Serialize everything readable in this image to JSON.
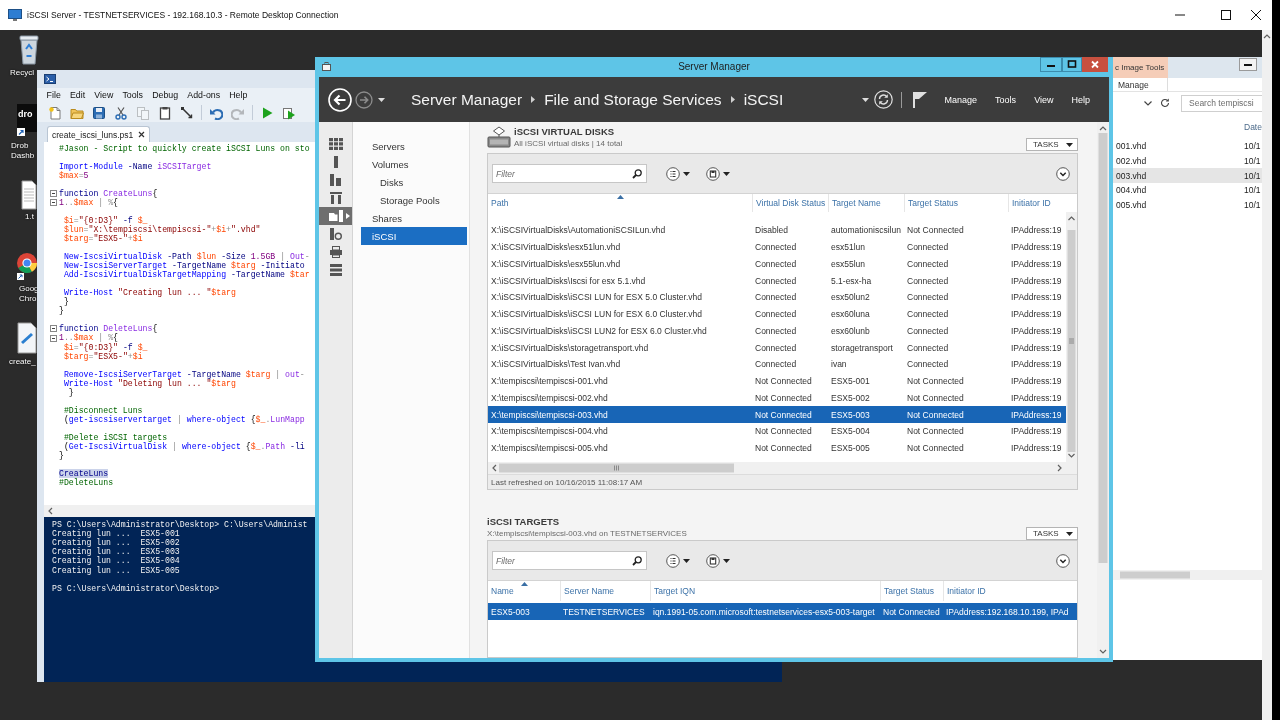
{
  "remote_desktop": {
    "title": "iSCSI Server - TESTNETSERVICES - 192.168.10.3 - Remote Desktop Connection"
  },
  "desktop_icons": [
    {
      "kind": "recycle-bin",
      "label": [
        "Recycl"
      ]
    },
    {
      "kind": "app-tile",
      "tile_text": "dro",
      "label": [
        "Drob",
        "Dashb"
      ]
    },
    {
      "kind": "text-file",
      "label": [
        "1.t"
      ]
    },
    {
      "kind": "browser",
      "label": [
        "Goog",
        "Chro"
      ]
    },
    {
      "kind": "script",
      "label": [
        "create_"
      ]
    }
  ],
  "ise": {
    "menu": [
      "File",
      "Edit",
      "View",
      "Tools",
      "Debug",
      "Add-ons",
      "Help"
    ],
    "toolbar": [
      [
        {
          "kind": "new",
          "disabled": false
        },
        {
          "kind": "open",
          "disabled": false
        },
        {
          "kind": "save",
          "disabled": false
        },
        {
          "kind": "cut",
          "disabled": false
        },
        {
          "kind": "copy",
          "disabled": true
        },
        {
          "kind": "paste",
          "disabled": false
        },
        {
          "kind": "clear",
          "disabled": false
        }
      ],
      [
        {
          "kind": "undo",
          "disabled": false
        },
        {
          "kind": "redo",
          "disabled": true
        }
      ],
      [
        {
          "kind": "run",
          "disabled": false
        },
        {
          "kind": "run-selection",
          "disabled": false
        }
      ]
    ],
    "tab": {
      "label": "create_iscsi_luns.ps1",
      "selected": true
    },
    "code": [
      [
        {
          "text": "#Jason - Script to quickly create iSCSI Luns on sto",
          "fold": false,
          "selected": false
        }
      ],
      [
        {
          "text": "Import-Module -Name iSCSITarget",
          "fold": false,
          "selected": false
        },
        {
          "text": "$max=5",
          "fold": false,
          "selected": false
        }
      ],
      [
        {
          "text": "function CreateLuns{",
          "fold": true,
          "selected": false
        },
        {
          "text": "1..$max | %{",
          "fold": true,
          "selected": false
        }
      ],
      [
        {
          "text": " $i=\"{0:D3}\" -f $_",
          "fold": false,
          "selected": false
        },
        {
          "text": " $lun=\"X:\\tempiscsi\\tempiscsi-\"+$i+\".vhd\"",
          "fold": false,
          "selected": false
        },
        {
          "text": " $targ=\"ESX5-\"+$i",
          "fold": false,
          "selected": false
        }
      ],
      [
        {
          "text": " New-IscsiVirtualDisk -Path $lun -Size 1.5GB | Out-",
          "fold": false,
          "selected": false
        },
        {
          "text": " New-IscsiServerTarget -TargetName $targ -Initiato",
          "fold": false,
          "selected": false
        },
        {
          "text": " Add-IscsiVirtualDiskTargetMapping -TargetName $tar",
          "fold": false,
          "selected": false
        }
      ],
      [
        {
          "text": " Write-Host \"Creating lun ... \"$targ",
          "fold": false,
          "selected": false
        },
        {
          "text": " }",
          "fold": false,
          "selected": false
        },
        {
          "text": "}",
          "fold": false,
          "selected": false
        }
      ],
      [
        {
          "text": "function DeleteLuns{",
          "fold": true,
          "selected": false
        },
        {
          "text": "1..$max | %{",
          "fold": true,
          "selected": false
        },
        {
          "text": " $i=\"{0:D3}\" -f $_",
          "fold": false,
          "selected": false
        },
        {
          "text": " $targ=\"ESX5-\"+$i",
          "fold": false,
          "selected": false
        }
      ],
      [
        {
          "text": " Remove-IscsiServerTarget -TargetName $targ | out-",
          "fold": false,
          "selected": false
        },
        {
          "text": " Write-Host \"Deleting lun ... \"$targ",
          "fold": false,
          "selected": false
        },
        {
          "text": "  }",
          "fold": false,
          "selected": false
        }
      ],
      [
        {
          "text": " #Disconnect Luns",
          "fold": false,
          "selected": false
        },
        {
          "text": " (get-iscsiservertarget | where-object {$_.LunMapp",
          "fold": false,
          "selected": false
        }
      ],
      [
        {
          "text": " #Delete iSCSI targets",
          "fold": false,
          "selected": false
        },
        {
          "text": " (Get-IscsiVirtualDisk | where-object {$_.Path -li",
          "fold": false,
          "selected": false
        },
        {
          "text": "}",
          "fold": false,
          "selected": false
        }
      ],
      [
        {
          "text": "CreateLuns",
          "fold": false,
          "selected": true
        },
        {
          "text": "#DeleteLuns",
          "fold": false,
          "selected": false
        }
      ]
    ],
    "console": [
      [
        "PS C:\\Users\\Administrator\\Desktop> C:\\Users\\Administ",
        "Creating lun ...  ESX5-001",
        "Creating lun ...  ESX5-002",
        "Creating lun ...  ESX5-003",
        "Creating lun ...  ESX5-004",
        "Creating lun ...  ESX5-005"
      ],
      [
        "PS C:\\Users\\Administrator\\Desktop>"
      ]
    ]
  },
  "server_manager": {
    "title": "Server Manager",
    "nav_buttons": [
      {
        "kind": "back",
        "disabled": false
      },
      {
        "kind": "forward",
        "disabled": true
      }
    ],
    "breadcrumb": [
      "Server Manager",
      "File and Storage Services",
      "iSCSI"
    ],
    "menu": [
      "Manage",
      "Tools",
      "View",
      "Help"
    ],
    "rail": [
      {
        "kind": "dashboard",
        "selected": false
      },
      {
        "kind": "local-server",
        "selected": false
      },
      {
        "kind": "all-servers",
        "selected": false
      },
      {
        "kind": "roles",
        "selected": false
      },
      {
        "kind": "file-storage",
        "selected": true
      },
      {
        "kind": "iis",
        "selected": false
      },
      {
        "kind": "print",
        "selected": false
      },
      {
        "kind": "remote",
        "selected": false
      }
    ],
    "nav": [
      {
        "label": "Servers",
        "selected": false
      },
      {
        "label": "Volumes",
        "selected": false,
        "children": [
          {
            "label": "Disks",
            "selected": false
          },
          {
            "label": "Storage Pools",
            "selected": false
          }
        ]
      },
      {
        "label": "Shares",
        "selected": false
      },
      {
        "label": "iSCSI",
        "selected": true
      }
    ],
    "virtual_disks": {
      "title": "iSCSI VIRTUAL DISKS",
      "subtitle": "All iSCSI virtual disks | 14 total",
      "tasks": "TASKS",
      "filter": {
        "placeholder": "Filter"
      },
      "columns": [
        {
          "label": "Path",
          "sorted": true
        },
        {
          "label": "Virtual Disk Status",
          "sorted": false
        },
        {
          "label": "Target Name",
          "sorted": false
        },
        {
          "label": "Target Status",
          "sorted": false
        },
        {
          "label": "Initiator ID",
          "sorted": false
        }
      ],
      "rows": [
        {
          "cells": [
            "X:\\iSCSIVirtualDisks\\AutomationiSCSILun.vhd",
            "Disabled",
            "automationiscsilun",
            "Not Connected",
            "IPAddress:19"
          ],
          "selected": false
        },
        {
          "cells": [
            "X:\\iSCSIVirtualDisks\\esx51lun.vhd",
            "Connected",
            "esx51lun",
            "Connected",
            "IPAddress:19"
          ],
          "selected": false
        },
        {
          "cells": [
            "X:\\iSCSIVirtualDisks\\esx55lun.vhd",
            "Connected",
            "esx55lun",
            "Connected",
            "IPAddress:19"
          ],
          "selected": false
        },
        {
          "cells": [
            "X:\\iSCSIVirtualDisks\\Iscsi for esx 5.1.vhd",
            "Connected",
            "5.1-esx-ha",
            "Connected",
            "IPAddress:19"
          ],
          "selected": false
        },
        {
          "cells": [
            "X:\\iSCSIVirtualDisks\\iSCSI LUN for ESX 5.0 Cluster.vhd",
            "Connected",
            "esx50lun2",
            "Connected",
            "IPAddress:19"
          ],
          "selected": false
        },
        {
          "cells": [
            "X:\\iSCSIVirtualDisks\\iSCSI LUN for ESX 6.0 Cluster.vhd",
            "Connected",
            "esx60luna",
            "Connected",
            "IPAddress:19"
          ],
          "selected": false
        },
        {
          "cells": [
            "X:\\iSCSIVirtualDisks\\iSCSI LUN2 for ESX 6.0 Cluster.vhd",
            "Connected",
            "esx60lunb",
            "Connected",
            "IPAddress:19"
          ],
          "selected": false
        },
        {
          "cells": [
            "X:\\iSCSIVirtualDisks\\storagetransport.vhd",
            "Connected",
            "storagetransport",
            "Connected",
            "IPAddress:19"
          ],
          "selected": false
        },
        {
          "cells": [
            "X:\\iSCSIVirtualDisks\\Test Ivan.vhd",
            "Connected",
            "ivan",
            "Connected",
            "IPAddress:19"
          ],
          "selected": false
        },
        {
          "cells": [
            "X:\\tempiscsi\\tempiscsi-001.vhd",
            "Not Connected",
            "ESX5-001",
            "Not Connected",
            "IPAddress:19"
          ],
          "selected": false
        },
        {
          "cells": [
            "X:\\tempiscsi\\tempiscsi-002.vhd",
            "Not Connected",
            "ESX5-002",
            "Not Connected",
            "IPAddress:19"
          ],
          "selected": false
        },
        {
          "cells": [
            "X:\\tempiscsi\\tempiscsi-003.vhd",
            "Not Connected",
            "ESX5-003",
            "Not Connected",
            "IPAddress:19"
          ],
          "selected": true
        },
        {
          "cells": [
            "X:\\tempiscsi\\tempiscsi-004.vhd",
            "Not Connected",
            "ESX5-004",
            "Not Connected",
            "IPAddress:19"
          ],
          "selected": false
        },
        {
          "cells": [
            "X:\\tempiscsi\\tempiscsi-005.vhd",
            "Not Connected",
            "ESX5-005",
            "Not Connected",
            "IPAddress:19"
          ],
          "selected": false
        }
      ],
      "footer": "Last refreshed on 10/16/2015 11:08:17 AM"
    },
    "targets": {
      "title": "iSCSI TARGETS",
      "subtitle": "X:\\tempiscsi\\tempiscsi-003.vhd on TESTNETSERVICES",
      "tasks": "TASKS",
      "filter": {
        "placeholder": "Filter"
      },
      "columns": [
        {
          "label": "Name",
          "sorted": true
        },
        {
          "label": "Server Name",
          "sorted": false
        },
        {
          "label": "Target IQN",
          "sorted": false
        },
        {
          "label": "Target Status",
          "sorted": false
        },
        {
          "label": "Initiator ID",
          "sorted": false
        }
      ],
      "rows": [
        {
          "cells": [
            "ESX5-003",
            "TESTNETSERVICES",
            "iqn.1991-05.com.microsoft:testnetservices-esx5-003-target",
            "Not Connected",
            "IPAddress:192.168.10.199, IPAd"
          ],
          "selected": true
        }
      ]
    }
  },
  "explorer": {
    "ribbon_tab": "c Image Tools",
    "ribbon_item": "Manage",
    "search": {
      "placeholder": "Search tempiscsi"
    },
    "columns": [
      "Date"
    ],
    "files": [
      {
        "name": "001.vhd",
        "date": "10/1",
        "selected": false
      },
      {
        "name": "002.vhd",
        "date": "10/1",
        "selected": false
      },
      {
        "name": "003.vhd",
        "date": "10/1",
        "selected": true
      },
      {
        "name": "004.vhd",
        "date": "10/1",
        "selected": false
      },
      {
        "name": "005.vhd",
        "date": "10/1",
        "selected": false
      }
    ]
  }
}
